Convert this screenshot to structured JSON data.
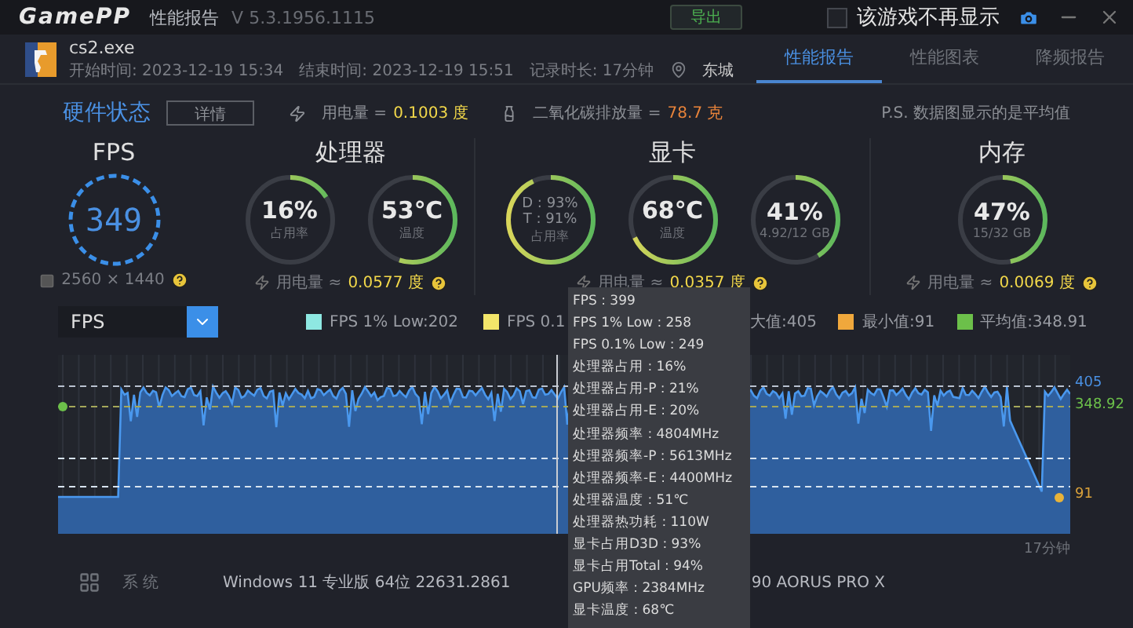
{
  "window": {
    "logo": "GamePP",
    "title": "性能报告",
    "version": "V 5.3.1956.1115",
    "export_button": "导出",
    "hide_option": {
      "label": "该游戏不再显示",
      "checked": false
    }
  },
  "game": {
    "name": "cs2.exe",
    "start": "开始时间: 2023-12-19 15:34",
    "end": "结束时间: 2023-12-19 15:51",
    "duration": "记录时长: 17分钟",
    "location": "东城"
  },
  "tabs": [
    {
      "label": "性能报告",
      "selected": true
    },
    {
      "label": "性能图表",
      "selected": false
    },
    {
      "label": "降频报告",
      "selected": false
    }
  ],
  "summary": {
    "title": "硬件状态",
    "details_button": "详情",
    "power_label": "用电量 =",
    "power_value": "0.1003 度",
    "co2_label": "二氧化碳排放量 =",
    "co2_value": "78.7 克",
    "note": "P.S. 数据图显示的是平均值"
  },
  "sections": [
    {
      "title": "FPS",
      "gauges": [
        {
          "kind": "fps",
          "value": "349"
        }
      ],
      "footer": {
        "kind": "resolution",
        "text": "2560 × 1440"
      }
    },
    {
      "title": "处理器",
      "gauges": [
        {
          "kind": "ring",
          "value": "16%",
          "caption": "占用率",
          "level": 0.16
        },
        {
          "kind": "ring",
          "value": "53℃",
          "caption": "温度",
          "level": 0.55
        }
      ],
      "footer": {
        "kind": "power",
        "label": "用电量 ≈",
        "value": "0.0577 度"
      }
    },
    {
      "title": "显卡",
      "gauges": [
        {
          "kind": "dual",
          "lines": [
            "D : 93%",
            "T : 91%"
          ],
          "caption": "占用率",
          "level": 0.93
        },
        {
          "kind": "ring",
          "value": "68℃",
          "caption": "温度",
          "level": 0.68
        },
        {
          "kind": "ring",
          "value": "41%",
          "caption": "4.92/12 GB",
          "level": 0.41
        }
      ],
      "footer": {
        "kind": "power",
        "label": "用电量 ≈",
        "value": "0.0357 度"
      }
    },
    {
      "title": "内存",
      "gauges": [
        {
          "kind": "ring",
          "value": "47%",
          "caption": "15/32 GB",
          "level": 0.47
        }
      ],
      "footer": {
        "kind": "power",
        "label": "用电量 ≈",
        "value": "0.0069 度"
      }
    }
  ],
  "chart": {
    "selector": "FPS",
    "legend": [
      {
        "text": "FPS 1% Low:202",
        "color": "#8ee8e2"
      },
      {
        "text": "FPS 0.1",
        "color": "#f3e66a"
      },
      {
        "text": "大值:405"
      },
      {
        "text": "最小值:91",
        "color": "#f0a83c"
      },
      {
        "text": "平均值:348.91",
        "color": "#6cc04a"
      }
    ],
    "max_label": "405",
    "avg_label": "348.92",
    "min_label": "91",
    "time_label": "17分钟",
    "tooltip": [
      "FPS : 399",
      "FPS 1% Low : 258",
      "FPS 0.1% Low : 249",
      "处理器占用 : 16%",
      "处理器占用-P : 21%",
      "处理器占用-E : 20%",
      "处理器频率 : 4804MHz",
      "处理器频率-P : 5613MHz",
      "处理器频率-E : 4400MHz",
      "处理器温度 : 51℃",
      "处理器热功耗 : 110W",
      "显卡占用D3D : 93%",
      "显卡占用Total : 94%",
      "GPU频率 : 2384MHz",
      "显卡温度 : 68℃"
    ]
  },
  "system_info": [
    {
      "label": "系 统",
      "value": "Windows 11 专业版 64位 22631.2861"
    }
  ],
  "board": "90 AORUS PRO X"
}
